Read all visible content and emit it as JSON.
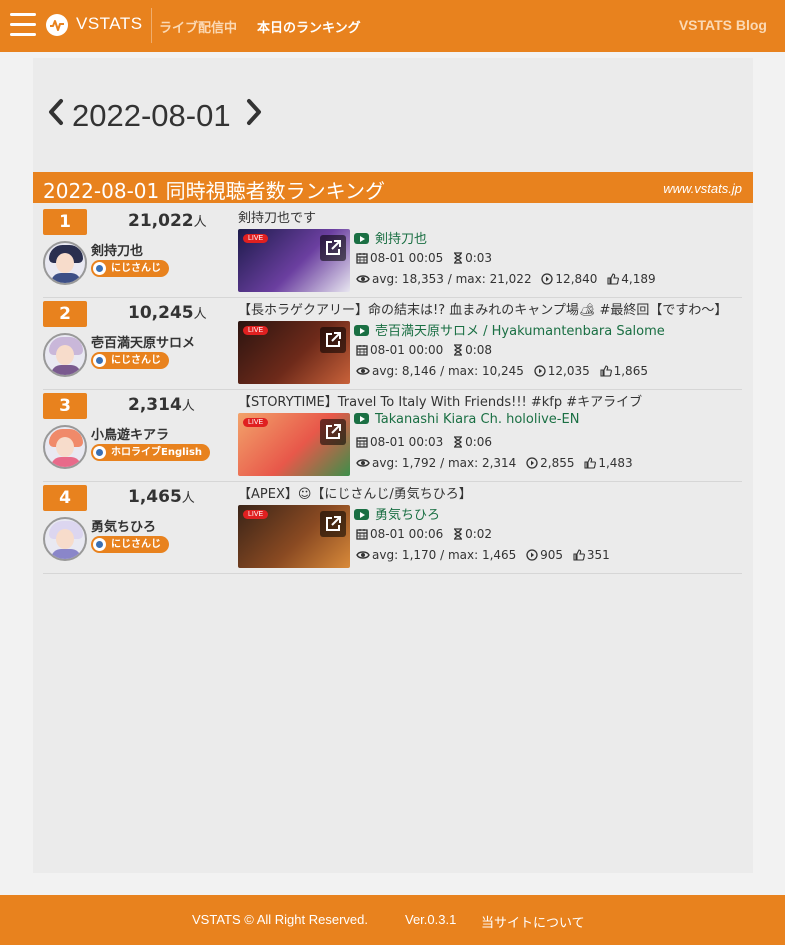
{
  "navbar": {
    "brand": "VSTATS",
    "live_link": "ライブ配信中",
    "ranking_link": "本日のランキング",
    "blog_link": "VSTATS Blog"
  },
  "date_nav": {
    "date": "2022-08-01",
    "prev_icon": "chevron-left-icon",
    "next_icon": "chevron-right-icon"
  },
  "ranking": {
    "title": "2022-08-01 同時視聴者数ランキング",
    "site": "www.vstats.jp",
    "unit": "人",
    "live_label": "LIVE",
    "rows": [
      {
        "rank": "1",
        "viewers": "21,022",
        "name": "剣持刀也",
        "agency": "にじさんじ",
        "video_title": "剣持刀也です",
        "channel": "剣持刀也",
        "start": "08-01 00:05",
        "duration": "0:03",
        "stats": "avg: 18,353 / max: 21,022",
        "plays": "12,840",
        "likes": "4,189",
        "thumb_colors": [
          "#1c1b4a",
          "#6b3fa0",
          "#e8e6f0"
        ],
        "avatar_colors": [
          "#2a2f4f",
          "#3d4f86"
        ]
      },
      {
        "rank": "2",
        "viewers": "10,245",
        "name": "壱百満天原サロメ",
        "agency": "にじさんじ",
        "video_title": "【長ホラゲクアリー】命の結末は!? 血まみれのキャンプ場🏕 #最終回【ですわ〜】",
        "channel": "壱百満天原サロメ / Hyakumantenbara Salome",
        "start": "08-01 00:00",
        "duration": "0:08",
        "stats": "avg: 8,146 / max: 10,245",
        "plays": "12,035",
        "likes": "1,865",
        "thumb_colors": [
          "#2b1410",
          "#6e2a1a",
          "#c9623a"
        ],
        "avatar_colors": [
          "#c9b7d9",
          "#7a5a8f"
        ]
      },
      {
        "rank": "3",
        "viewers": "2,314",
        "name": "小鳥遊キアラ",
        "agency": "ホロライブEnglish",
        "video_title": "【STORYTIME】Travel To Italy With Friends!!! #kfp #キアライブ",
        "channel": "Takanashi Kiara Ch. hololive-EN",
        "start": "08-01 00:03",
        "duration": "0:06",
        "stats": "avg: 1,792 / max: 2,314",
        "plays": "2,855",
        "likes": "1,483",
        "thumb_colors": [
          "#f2a36b",
          "#e8584a",
          "#3d8f4a"
        ],
        "avatar_colors": [
          "#f08a6a",
          "#e86a8a"
        ]
      },
      {
        "rank": "4",
        "viewers": "1,465",
        "name": "勇気ちひろ",
        "agency": "にじさんじ",
        "video_title": "【APEX】☺【にじさんじ/勇気ちひろ】",
        "channel": "勇気ちひろ",
        "start": "08-01 00:06",
        "duration": "0:02",
        "stats": "avg: 1,170 / max: 1,465",
        "plays": "905",
        "likes": "351",
        "thumb_colors": [
          "#3a2418",
          "#8a4a22",
          "#d98a3a"
        ],
        "avatar_colors": [
          "#dcd6f0",
          "#8a86c9"
        ]
      }
    ]
  },
  "footer": {
    "copyright": "VSTATS © All Right Reserved.",
    "version": "Ver.0.3.1",
    "about": "当サイトについて"
  },
  "colors": {
    "brand_orange": "#e8821e",
    "channel_green": "#1a6f43",
    "live_red": "#e02020"
  }
}
